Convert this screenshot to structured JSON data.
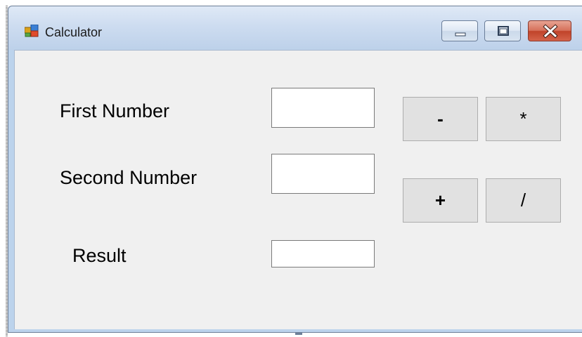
{
  "window": {
    "title": "Calculator",
    "icon": "windows-form-icon",
    "caption_buttons": {
      "minimize_icon": "minimize-icon",
      "restore_icon": "restore-icon",
      "close_icon": "close-icon"
    }
  },
  "form": {
    "first_number_label": "First Number",
    "second_number_label": "Second Number",
    "result_label": "Result",
    "first_number_value": "",
    "second_number_value": "",
    "result_value": ""
  },
  "operators": {
    "minus": "-",
    "multiply": "*",
    "plus": "+",
    "divide": "/"
  },
  "colors": {
    "client_background": "#f0f0f0",
    "button_face": "#e1e1e1",
    "close_button": "#c0432a",
    "title_bar": "#cddcf0"
  }
}
